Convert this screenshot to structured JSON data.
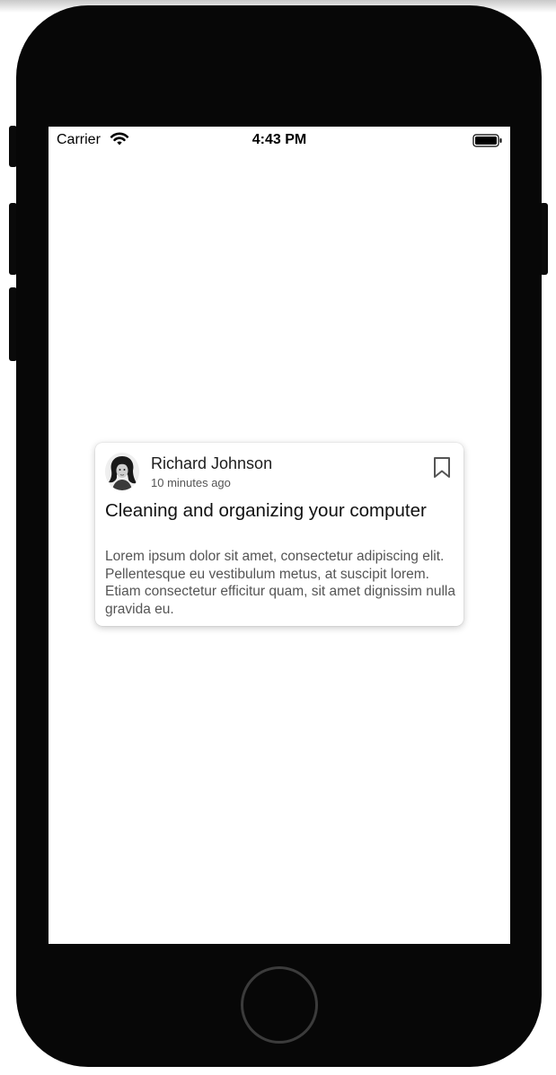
{
  "status_bar": {
    "carrier": "Carrier",
    "time": "4:43 PM",
    "icons": [
      "wifi-icon",
      "battery-icon"
    ]
  },
  "card": {
    "author": {
      "name": "Richard Johnson",
      "time": "10 minutes ago",
      "avatar_icon": "avatar-portrait"
    },
    "bookmark_icon": "bookmark-icon",
    "title": "Cleaning and organizing your computer",
    "body": "Lorem ipsum dolor sit amet, consectetur adipiscing elit. Pellentesque eu vestibulum metus, at suscipit lorem. Etiam consectetur efficitur quam, sit amet dignissim nulla gravida eu."
  },
  "colors": {
    "device_frame": "#070707",
    "screen_background": "#ffffff",
    "title_text": "#111111",
    "body_text": "#555555"
  }
}
